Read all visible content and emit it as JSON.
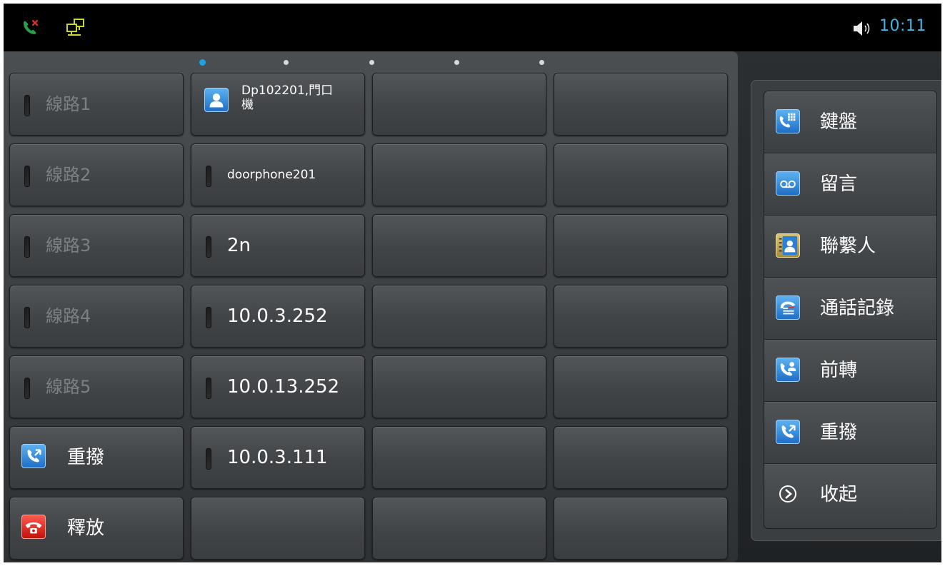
{
  "status_bar": {
    "icons": [
      "missed-call-icon",
      "network-icon",
      "volume-icon"
    ],
    "time": "10:11"
  },
  "pager": {
    "pages": 5,
    "active_page": 1
  },
  "column1": [
    {
      "label": "線路1",
      "type": "line"
    },
    {
      "label": "線路2",
      "type": "line"
    },
    {
      "label": "線路3",
      "type": "line"
    },
    {
      "label": "線路4",
      "type": "line"
    },
    {
      "label": "線路5",
      "type": "line"
    },
    {
      "label": "重撥",
      "type": "redial",
      "icon": "redial-icon"
    },
    {
      "label": "釋放",
      "type": "release",
      "icon": "hangup-icon"
    }
  ],
  "column2": [
    {
      "label_line1": "Dp102201,門口",
      "label_line2": "機",
      "icon": "contact-icon"
    },
    {
      "label": "doorphone201"
    },
    {
      "label": "2n"
    },
    {
      "label": "10.0.3.252"
    },
    {
      "label": "10.0.13.252"
    },
    {
      "label": "10.0.3.111"
    },
    {
      "label": ""
    }
  ],
  "side_menu": [
    {
      "label": "鍵盤",
      "icon": "keypad-icon"
    },
    {
      "label": "留言",
      "icon": "voicemail-icon"
    },
    {
      "label": "聯繫人",
      "icon": "contacts-icon"
    },
    {
      "label": "通話記錄",
      "icon": "call-history-icon"
    },
    {
      "label": "前轉",
      "icon": "forward-icon"
    },
    {
      "label": "重撥",
      "icon": "redial-icon"
    },
    {
      "label": "收起",
      "icon": "collapse-icon"
    }
  ],
  "colors": {
    "accent": "#1aa3e0",
    "dim_text": "#7c8084",
    "release_red": "#d8251b",
    "icon_blue": "#2a7fd6"
  }
}
